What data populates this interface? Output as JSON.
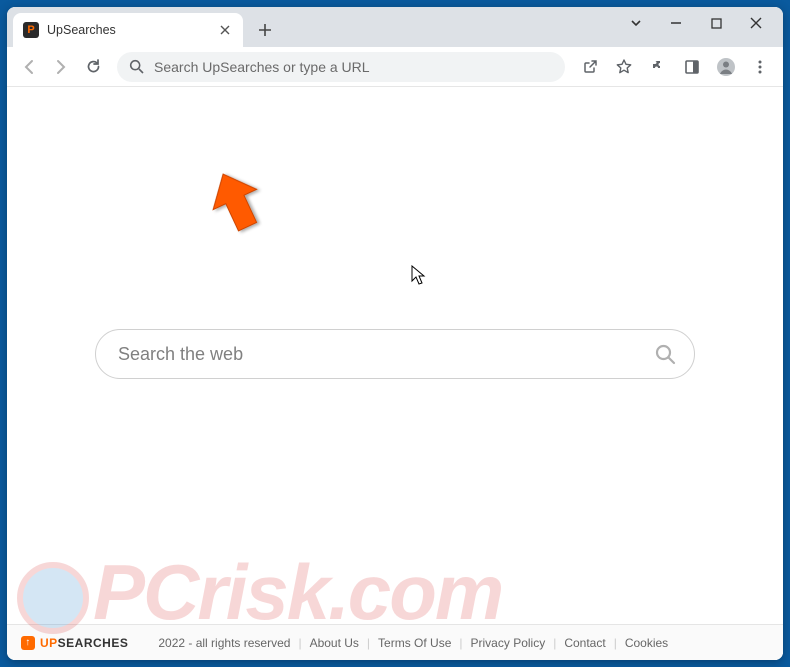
{
  "tab": {
    "title": "UpSearches",
    "favicon_letter": "P"
  },
  "omnibox": {
    "placeholder": "Search UpSearches or type a URL"
  },
  "page": {
    "search_placeholder": "Search the web"
  },
  "footer": {
    "logo_up": "UP",
    "logo_searches": "SEARCHES",
    "copyright": "2022 - all rights reserved",
    "links": {
      "about": "About Us",
      "terms": "Terms Of Use",
      "privacy": "Privacy Policy",
      "contact": "Contact",
      "cookies": "Cookies"
    }
  },
  "watermark": "PCrisk.com"
}
